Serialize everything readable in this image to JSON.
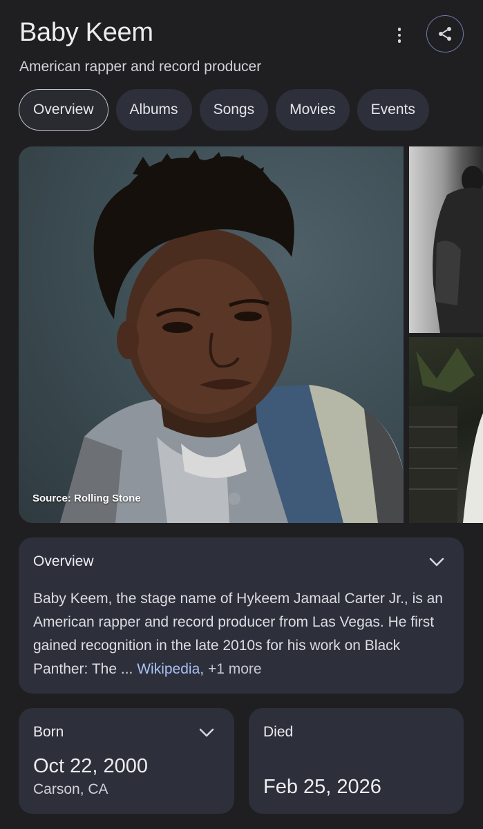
{
  "header": {
    "title": "Baby Keem",
    "subtitle": "American rapper and record producer"
  },
  "icons": {
    "more": "more-vert-icon",
    "share": "share-icon",
    "expand": "chevron-down-icon"
  },
  "tabs": [
    {
      "label": "Overview",
      "active": true
    },
    {
      "label": "Albums",
      "active": false
    },
    {
      "label": "Songs",
      "active": false
    },
    {
      "label": "Movies",
      "active": false
    },
    {
      "label": "Events",
      "active": false
    }
  ],
  "images": {
    "main_source": "Source: Rolling Stone"
  },
  "overview": {
    "heading": "Overview",
    "text": "Baby Keem, the stage name of Hykeem Jamaal Carter Jr., is an American rapper and record producer from Las Vegas. He first gained recognition in the late 2010s for his work on Black Panther: The ...",
    "source_link": "Wikipedia",
    "separator": ",",
    "more_label": "+1 more"
  },
  "facts": {
    "born": {
      "label": "Born",
      "date": "Oct 22, 2000",
      "place": "Carson, CA"
    },
    "died": {
      "label": "Died",
      "date": "Feb 25, 2026"
    }
  },
  "colors": {
    "background": "#1f1f22",
    "card": "#2d303b",
    "link": "#a8c1f5",
    "share_ring": "#6f7aa8"
  }
}
